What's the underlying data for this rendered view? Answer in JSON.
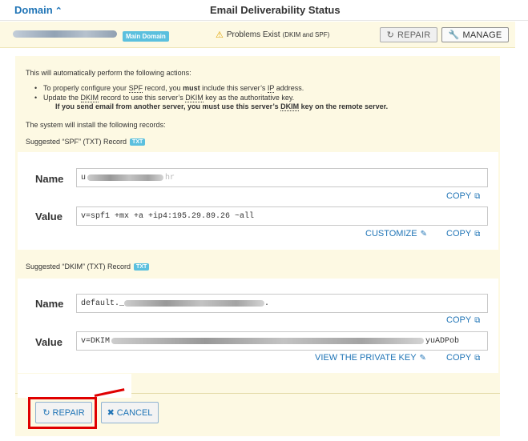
{
  "header": {
    "domain_label": "Domain",
    "status_label": "Email Deliverability Status"
  },
  "domain_row": {
    "main_badge": "Main Domain",
    "problem_text": "Problems Exist",
    "problem_detail": "(DKIM and SPF)",
    "repair_label": "REPAIR",
    "manage_label": "MANAGE"
  },
  "panel": {
    "intro": "This will automatically perform the following actions:",
    "bullet1_pre": "To properly configure your ",
    "bullet1_spf": "SPF",
    "bullet1_mid": " record, you ",
    "bullet1_must": "must",
    "bullet1_mid2": " include this server’s ",
    "bullet1_ip": "IP",
    "bullet1_end": " address.",
    "bullet2_pre": "Update the ",
    "bullet2_dkim": "DKIM",
    "bullet2_mid": " record to use this server’s ",
    "bullet2_dkim2": "DKIM",
    "bullet2_end": " key as the authoritative key.",
    "bullet2_bold_pre": "If you send email from another server, you must use this server’s ",
    "bullet2_bold_dkim": "DKIM",
    "bullet2_bold_end": " key on the remote server.",
    "install_text": "The system will install the following records:"
  },
  "spf": {
    "title": "Suggested “SPF” (TXT) Record",
    "badge": "TXT",
    "name_label": "Name",
    "value_label": "Value",
    "name_prefix": "u",
    "name_suffix": "hr",
    "value": "v=spf1 +mx +a +ip4:195.29.89.26 ~all",
    "copy_label": "COPY",
    "customize_label": "CUSTOMIZE"
  },
  "dkim": {
    "title": "Suggested “DKIM” (TXT) Record",
    "badge": "TXT",
    "name_label": "Name",
    "value_label": "Value",
    "name_prefix": "default._",
    "name_suffix": ".",
    "value_prefix": "v=DKIM",
    "value_suffix": "yuADPob",
    "copy_label": "COPY",
    "private_key_label": "VIEW THE PRIVATE KEY"
  },
  "footer": {
    "repair_label": "REPAIR",
    "cancel_label": "CANCEL"
  },
  "colors": {
    "accent": "#1f74b6",
    "badge": "#5bc0de",
    "panel_bg": "#fdf9e3",
    "warning": "#e0a300",
    "highlight": "#e00000"
  }
}
